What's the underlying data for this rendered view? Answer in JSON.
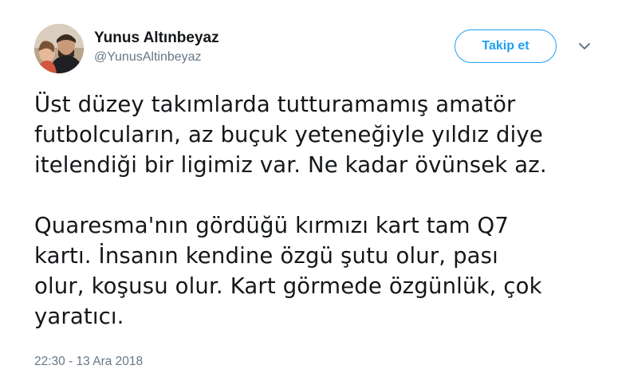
{
  "author": {
    "display_name": "Yunus Altınbeyaz",
    "handle": "@YunusAltinbeyaz"
  },
  "actions": {
    "follow_label": "Takip et",
    "menu_icon": "chevron-down-icon"
  },
  "tweet": {
    "paragraphs": [
      {
        "lines": [
          "Üst düzey takımlarda tutturamamış amatör",
          "futbolcuların, az buçuk yeteneğiyle yıldız diye",
          "itelendiği bir ligimiz var. Ne kadar övünsek az."
        ]
      },
      {
        "lines": [
          "Quaresma'nın gördüğü kırmızı kart tam Q7",
          "kartı. İnsanın kendine özgü şutu olur, pası",
          "olur, koşusu olur. Kart görmede özgünlük, çok",
          "yaratıcı."
        ]
      }
    ],
    "timestamp": "22:30 - 13 Ara 2018"
  },
  "colors": {
    "accent": "#1da1f2",
    "text_primary": "#14171a",
    "text_secondary": "#657786"
  }
}
